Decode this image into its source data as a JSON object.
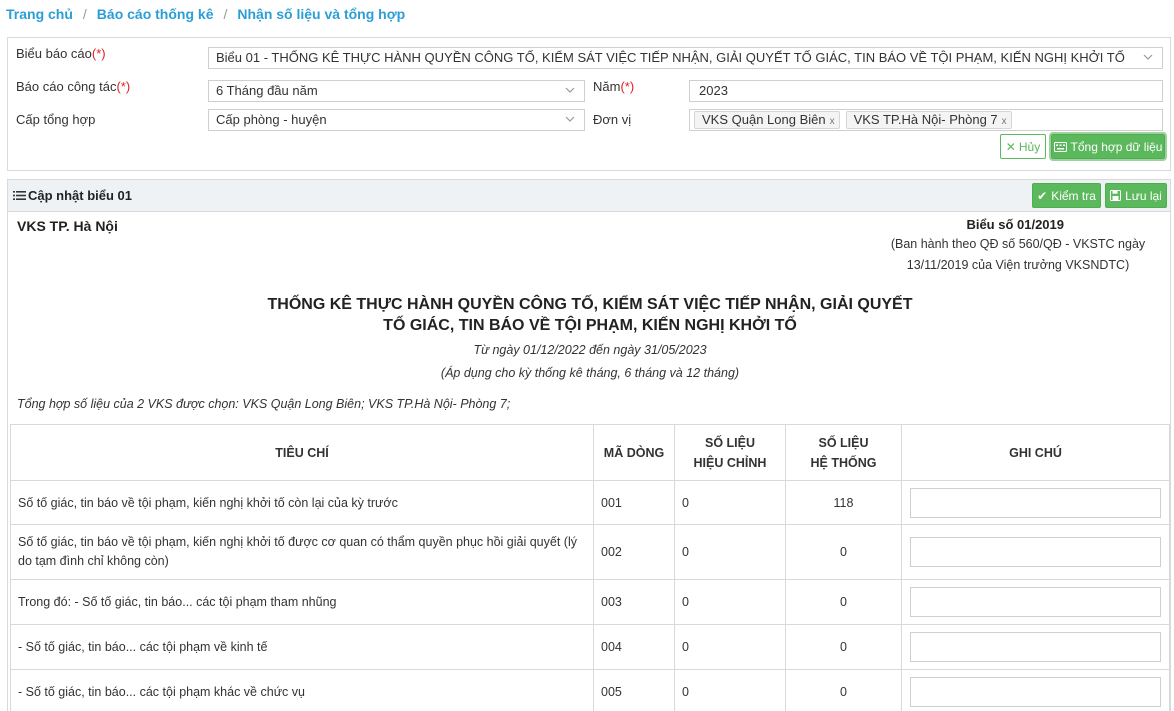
{
  "breadcrumb": {
    "items": [
      "Trang chủ",
      "Báo cáo thống kê",
      "Nhận số liệu và tổng hợp"
    ]
  },
  "filters": {
    "report_form_label": "Biểu báo cáo",
    "report_form_value": "Biểu 01 - THỐNG KÊ THỰC HÀNH QUYỀN CÔNG TỐ, KIỂM SÁT VIỆC TIẾP NHẬN, GIẢI QUYẾT TỐ GIÁC, TIN BÁO VỀ TỘI PHẠM, KIẾN NGHỊ KHỞI TỐ",
    "work_report_label": "Báo cáo công tác",
    "work_report_value": "6 Tháng đầu năm",
    "year_label": "Năm",
    "year_value": "2023",
    "level_label": "Cấp tổng hợp",
    "level_value": "Cấp phòng - huyện",
    "unit_label": "Đơn vị",
    "unit_chips": [
      "VKS Quận Long Biên",
      "VKS TP.Hà Nội- Phòng 7"
    ],
    "required_mark": "(*)",
    "chip_remove": "x",
    "cancel_label": "Hủy",
    "aggregate_label": "Tổng hợp dữ liệu"
  },
  "section": {
    "title": "Cập nhật biểu 01",
    "check_label": "Kiểm tra",
    "save_label": "Lưu lại"
  },
  "report": {
    "org": "VKS TP. Hà Nội",
    "form_no": "Biểu số 01/2019",
    "issued_line1": "(Ban hành theo QĐ số 560/QĐ - VKSTC ngày",
    "issued_line2": "13/11/2019 của Viện trưởng VKSNDTC)",
    "title_line1": "THỐNG KÊ THỰC HÀNH QUYỀN CÔNG TỐ, KIỂM SÁT VIỆC TIẾP NHẬN, GIẢI QUYẾT",
    "title_line2": "TỐ GIÁC, TIN BÁO VỀ TỘI PHẠM, KIẾN NGHỊ KHỞI TỐ",
    "period": "Từ ngày 01/12/2022 đến ngày 31/05/2023",
    "apply": "(Áp dụng cho kỳ thống kê tháng, 6 tháng và 12 tháng)",
    "summary": "Tổng hợp số liệu của 2 VKS được chọn: VKS Quận Long Biên; VKS TP.Hà Nội- Phòng 7;"
  },
  "table": {
    "headers": {
      "criteria": "TIÊU CHÍ",
      "line_code": "MÃ DÒNG",
      "adjusted_1": "SỐ LIỆU",
      "adjusted_2": "HIỆU CHỈNH",
      "system_1": "SỐ LIỆU",
      "system_2": "HỆ THỐNG",
      "note": "GHI CHÚ"
    },
    "rows": [
      {
        "criteria": "Số tố giác, tin báo về tội phạm, kiến nghị khởi tố còn lại của kỳ trước",
        "code": "001",
        "adjusted": "0",
        "system": "118"
      },
      {
        "criteria": "Số tố giác, tin báo về tội phạm, kiến nghị khởi tố được cơ quan có thẩm quyền phục hồi giải quyết (lý do tạm đình chỉ không còn)",
        "code": "002",
        "adjusted": "0",
        "system": "0"
      },
      {
        "criteria": "Trong đó: - Số tố giác, tin báo... các tội phạm tham nhũng",
        "code": "003",
        "adjusted": "0",
        "system": "0"
      },
      {
        "criteria": "- Số tố giác, tin báo... các tội phạm về kinh tế",
        "code": "004",
        "adjusted": "0",
        "system": "0"
      },
      {
        "criteria": "- Số tố giác, tin báo... các tội phạm khác về chức vụ",
        "code": "005",
        "adjusted": "0",
        "system": "0"
      }
    ]
  },
  "colors": {
    "link": "#2b9ed6",
    "green": "#5cb85c",
    "required": "#e02020",
    "header_bg": "#eef2f5"
  },
  "icons": {
    "chevron": "chevron-down-icon",
    "cancel": "close-icon",
    "aggregate": "keyboard-icon",
    "list": "list-icon",
    "check": "check-icon",
    "save": "floppy-disk-icon"
  }
}
